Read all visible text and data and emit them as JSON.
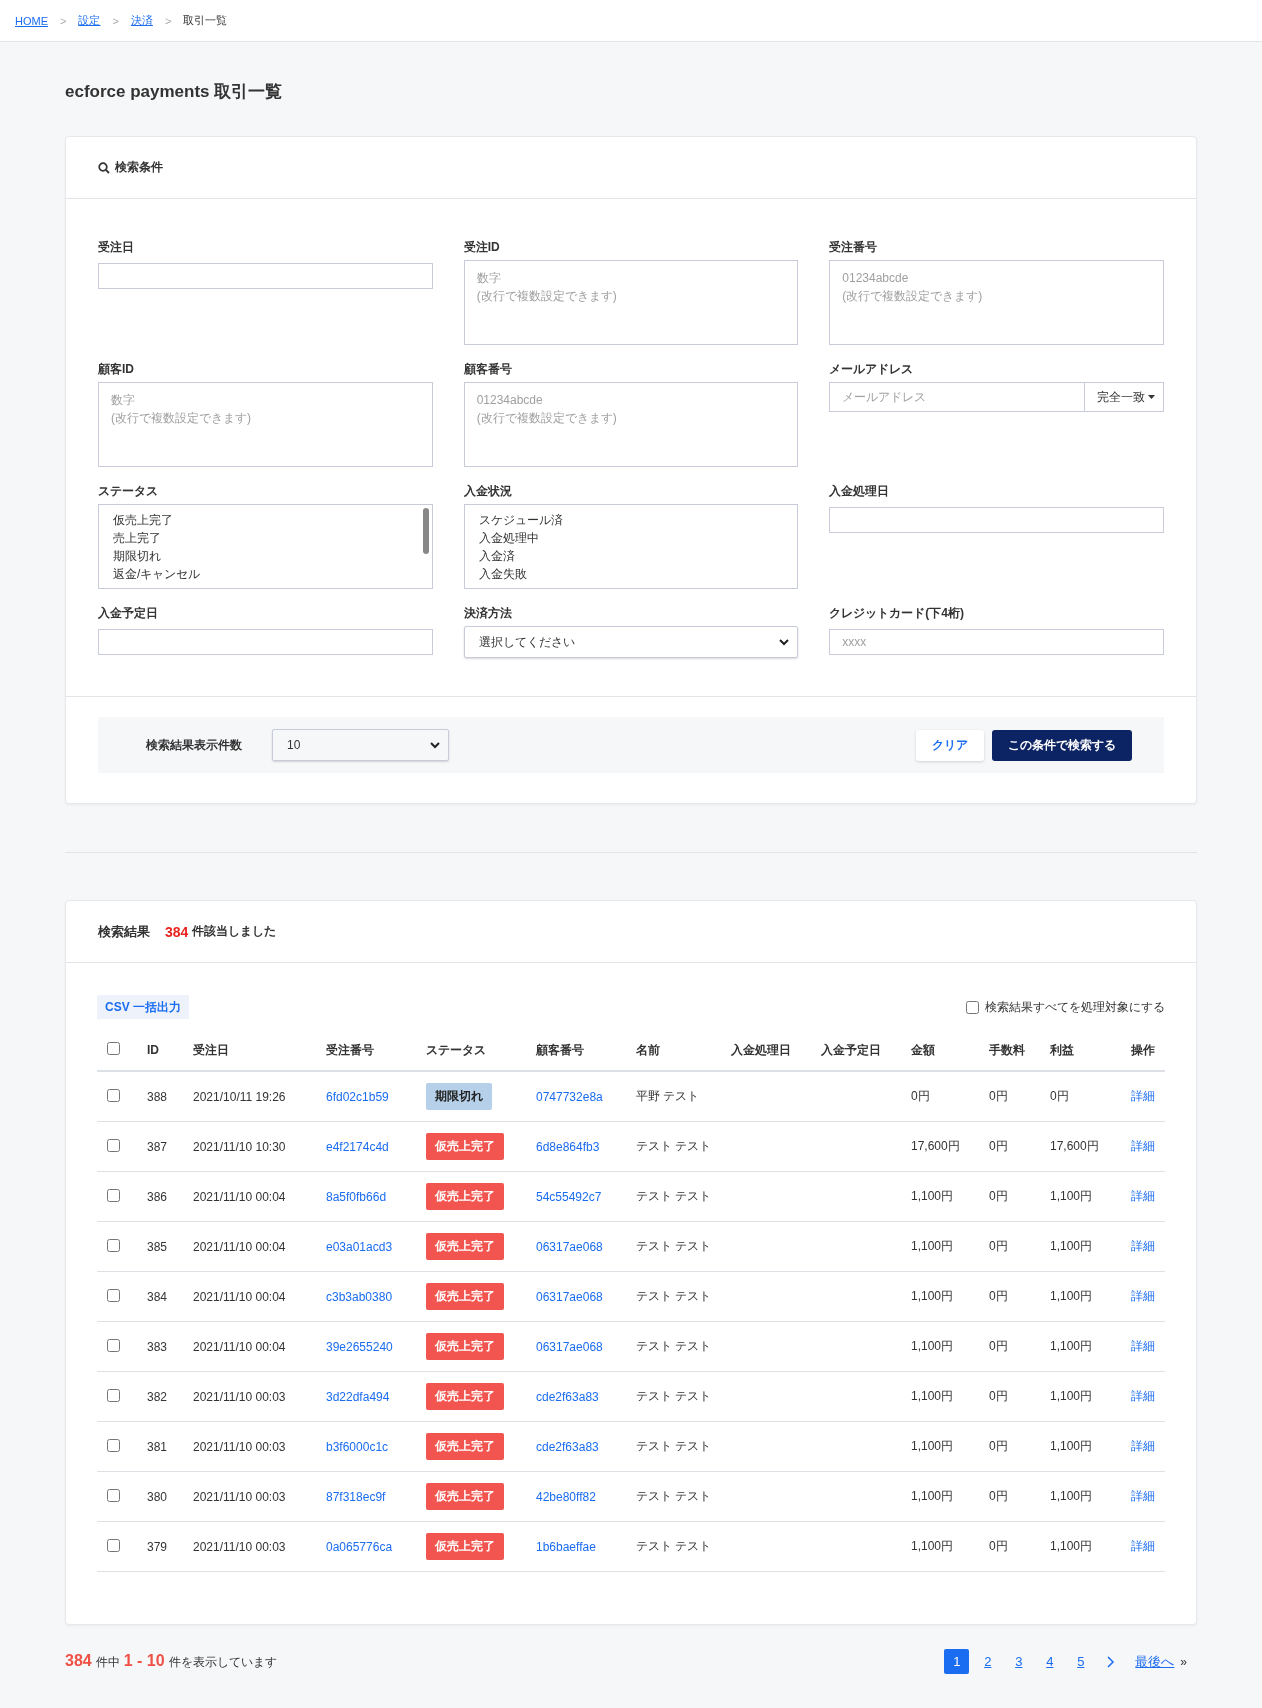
{
  "breadcrumb": [
    {
      "label": "HOME",
      "link": true
    },
    {
      "label": "設定",
      "link": true
    },
    {
      "label": "決済",
      "link": true
    },
    {
      "label": "取引一覧",
      "link": false
    }
  ],
  "separator": ">",
  "page_title": "ecforce payments 取引一覧",
  "search": {
    "title": "検索条件",
    "fields": [
      {
        "kind": "input",
        "label": "受注日"
      },
      {
        "kind": "textarea",
        "label": "受注ID",
        "placeholder": "数字\n(改行で複数設定できます)"
      },
      {
        "kind": "textarea",
        "label": "受注番号",
        "placeholder": "01234abcde\n(改行で複数設定できます)"
      },
      {
        "kind": "textarea",
        "label": "顧客ID",
        "placeholder": "数字\n(改行で複数設定できます)"
      },
      {
        "kind": "textarea",
        "label": "顧客番号",
        "placeholder": "01234abcde\n(改行で複数設定できます)"
      },
      {
        "kind": "email",
        "label": "メールアドレス",
        "placeholder": "メールアドレス",
        "match": "完全一致"
      },
      {
        "kind": "listbox",
        "label": "ステータス",
        "scrollable": true,
        "options": [
          {
            "label": "仮売上完了",
            "selected": false
          },
          {
            "label": "売上完了",
            "selected": false
          },
          {
            "label": "期限切れ",
            "selected": false
          },
          {
            "label": "返金/キャンセル",
            "selected": false
          }
        ]
      },
      {
        "kind": "listbox",
        "label": "入金状況",
        "scrollable": false,
        "options": [
          {
            "label": "スケジュール済",
            "selected": false
          },
          {
            "label": "入金処理中",
            "selected": false
          },
          {
            "label": "入金済",
            "selected": false
          },
          {
            "label": "入金失敗",
            "selected": false
          }
        ]
      },
      {
        "kind": "input",
        "label": "入金処理日"
      },
      {
        "kind": "input",
        "label": "入金予定日"
      },
      {
        "kind": "select",
        "label": "決済方法",
        "value": "選択してください"
      },
      {
        "kind": "input",
        "label": "クレジットカード(下4桁)",
        "placeholder": "xxxx"
      }
    ],
    "per_page_label": "検索結果表示件数",
    "per_page": "10",
    "clear": "クリア",
    "submit": "この条件で検索する"
  },
  "results": {
    "title": "検索結果",
    "count": "384",
    "count_suffix": "件該当しました",
    "csv": "CSV 一括出力",
    "select_all_label": "検索結果すべてを処理対象にする",
    "select_all_checked": false,
    "header_checked": false,
    "columns": [
      "ID",
      "受注日",
      "受注番号",
      "ステータス",
      "顧客番号",
      "名前",
      "入金処理日",
      "入金予定日",
      "金額",
      "手数料",
      "利益",
      "操作"
    ],
    "rows": [
      {
        "checked": false,
        "id": "388",
        "date": "2021/10/11 19:26",
        "order_no": "6fd02c1b59",
        "status": {
          "label": "期限切れ",
          "kind": "expired"
        },
        "customer_no": "0747732e8a",
        "name": "平野 テスト",
        "amount": "0円",
        "fee": "0円",
        "profit": "0円",
        "action": "詳細"
      },
      {
        "checked": false,
        "id": "387",
        "date": "2021/11/10 10:30",
        "order_no": "e4f2174c4d",
        "status": {
          "label": "仮売上完了",
          "kind": "authorized"
        },
        "customer_no": "6d8e864fb3",
        "name": "テスト テスト",
        "amount": "17,600円",
        "fee": "0円",
        "profit": "17,600円",
        "action": "詳細"
      },
      {
        "checked": false,
        "id": "386",
        "date": "2021/11/10 00:04",
        "order_no": "8a5f0fb66d",
        "status": {
          "label": "仮売上完了",
          "kind": "authorized"
        },
        "customer_no": "54c55492c7",
        "name": "テスト テスト",
        "amount": "1,100円",
        "fee": "0円",
        "profit": "1,100円",
        "action": "詳細"
      },
      {
        "checked": false,
        "id": "385",
        "date": "2021/11/10 00:04",
        "order_no": "e03a01acd3",
        "status": {
          "label": "仮売上完了",
          "kind": "authorized"
        },
        "customer_no": "06317ae068",
        "name": "テスト テスト",
        "amount": "1,100円",
        "fee": "0円",
        "profit": "1,100円",
        "action": "詳細"
      },
      {
        "checked": false,
        "id": "384",
        "date": "2021/11/10 00:04",
        "order_no": "c3b3ab0380",
        "status": {
          "label": "仮売上完了",
          "kind": "authorized"
        },
        "customer_no": "06317ae068",
        "name": "テスト テスト",
        "amount": "1,100円",
        "fee": "0円",
        "profit": "1,100円",
        "action": "詳細"
      },
      {
        "checked": false,
        "id": "383",
        "date": "2021/11/10 00:04",
        "order_no": "39e2655240",
        "status": {
          "label": "仮売上完了",
          "kind": "authorized"
        },
        "customer_no": "06317ae068",
        "name": "テスト テスト",
        "amount": "1,100円",
        "fee": "0円",
        "profit": "1,100円",
        "action": "詳細"
      },
      {
        "checked": false,
        "id": "382",
        "date": "2021/11/10 00:03",
        "order_no": "3d22dfa494",
        "status": {
          "label": "仮売上完了",
          "kind": "authorized"
        },
        "customer_no": "cde2f63a83",
        "name": "テスト テスト",
        "amount": "1,100円",
        "fee": "0円",
        "profit": "1,100円",
        "action": "詳細"
      },
      {
        "checked": false,
        "id": "381",
        "date": "2021/11/10 00:03",
        "order_no": "b3f6000c1c",
        "status": {
          "label": "仮売上完了",
          "kind": "authorized"
        },
        "customer_no": "cde2f63a83",
        "name": "テスト テスト",
        "amount": "1,100円",
        "fee": "0円",
        "profit": "1,100円",
        "action": "詳細"
      },
      {
        "checked": false,
        "id": "380",
        "date": "2021/11/10 00:03",
        "order_no": "87f318ec9f",
        "status": {
          "label": "仮売上完了",
          "kind": "authorized"
        },
        "customer_no": "42be80ff82",
        "name": "テスト テスト",
        "amount": "1,100円",
        "fee": "0円",
        "profit": "1,100円",
        "action": "詳細"
      },
      {
        "checked": false,
        "id": "379",
        "date": "2021/11/10 00:03",
        "order_no": "0a065776ca",
        "status": {
          "label": "仮売上完了",
          "kind": "authorized"
        },
        "customer_no": "1b6baeffae",
        "name": "テスト テスト",
        "amount": "1,100円",
        "fee": "0円",
        "profit": "1,100円",
        "action": "詳細"
      }
    ]
  },
  "footer": {
    "total": "384",
    "total_suffix": "件中",
    "range": "1 - 10",
    "range_suffix": "件を表示しています",
    "pages": [
      {
        "label": "1",
        "selected": true
      },
      {
        "label": "2",
        "selected": false
      },
      {
        "label": "3",
        "selected": false
      },
      {
        "label": "4",
        "selected": false
      },
      {
        "label": "5",
        "selected": false
      }
    ],
    "last": "最後へ",
    "last_mark": "»"
  }
}
